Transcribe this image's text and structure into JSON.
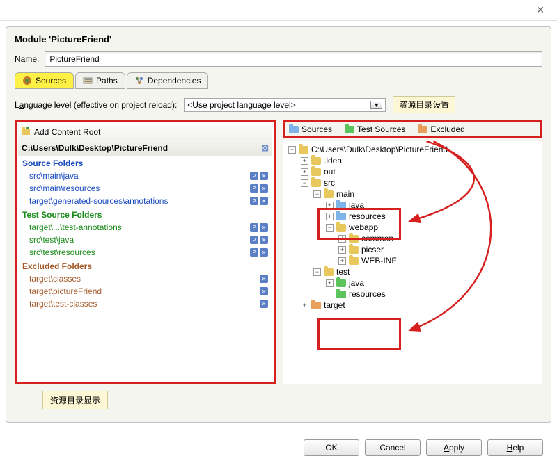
{
  "module_title": "Module 'PictureFriend'",
  "name_label": "Name:",
  "name_value": "PictureFriend",
  "tabs": {
    "sources": "Sources",
    "paths": "Paths",
    "dependencies": "Dependencies"
  },
  "lang_label": "Language level (effective on project reload):",
  "lang_value": "<Use project language level>",
  "callout_top": "资源目录设置",
  "callout_bottom": "资源目录显示",
  "left": {
    "add_root": "Add Content Root",
    "root_path": "C:\\Users\\Dulk\\Desktop\\PictureFriend",
    "sections": {
      "source": {
        "title": "Source Folders",
        "items": [
          "src\\main\\java",
          "src\\main\\resources",
          "target\\generated-sources\\annotations"
        ]
      },
      "test": {
        "title": "Test Source Folders",
        "items": [
          "target\\...\\test-annotations",
          "src\\test\\java",
          "src\\test\\resources"
        ]
      },
      "excluded": {
        "title": "Excluded Folders",
        "items": [
          "target\\classes",
          "target\\pictureFriend",
          "target\\test-classes"
        ]
      }
    }
  },
  "right": {
    "legend": {
      "sources": "Sources",
      "test": "Test Sources",
      "excluded": "Excluded"
    },
    "tree": {
      "root": "C:\\Users\\Dulk\\Desktop\\PictureFriend",
      "idea": ".idea",
      "out": "out",
      "src": "src",
      "main": "main",
      "main_java": "java",
      "main_res": "resources",
      "webapp": "webapp",
      "common": "common",
      "picser": "picser",
      "webinf": "WEB-INF",
      "test": "test",
      "test_java": "java",
      "test_res": "resources",
      "target": "target"
    }
  },
  "buttons": {
    "ok": "OK",
    "cancel": "Cancel",
    "apply": "Apply",
    "help": "Help"
  }
}
